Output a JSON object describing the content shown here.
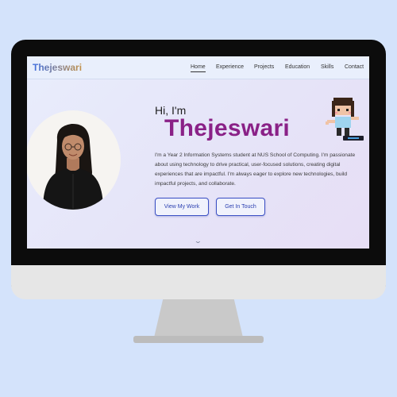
{
  "nav": {
    "logo": "Thejeswari",
    "links": [
      {
        "label": "Home",
        "active": true
      },
      {
        "label": "Experience"
      },
      {
        "label": "Projects"
      },
      {
        "label": "Education"
      },
      {
        "label": "Skills"
      },
      {
        "label": "Contact"
      }
    ]
  },
  "hero": {
    "greeting": "Hi, I'm",
    "name": "Thejeswari",
    "bio": "I'm a Year 2 Information Systems student at NUS School of Computing. I'm passionate about using technology to drive practical, user-focused solutions, creating digital experiences that are impactful. I'm always eager to explore new technologies, build impactful projects, and collaborate.",
    "primary_button": "View My Work",
    "secondary_button": "Get In Touch",
    "scroll_icon": "chevron-down-icon"
  },
  "colors": {
    "background": "#d4e3fb",
    "name_accent": "#8a2187",
    "button_border": "#3a4fc4"
  }
}
